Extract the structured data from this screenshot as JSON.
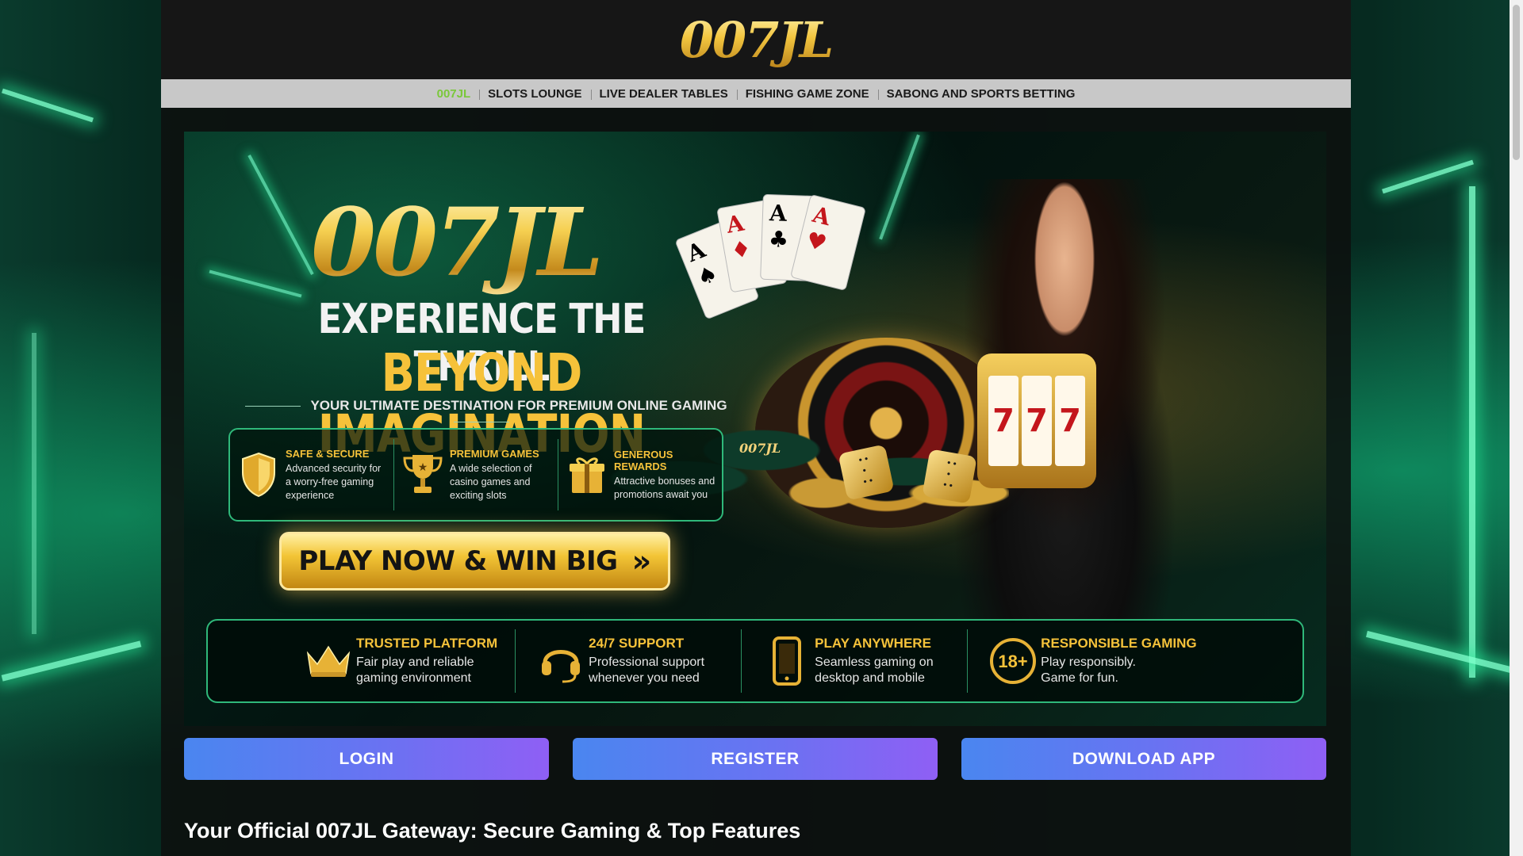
{
  "site": {
    "logo_text": "007JL"
  },
  "nav": {
    "items": [
      {
        "label": "007JL",
        "active": true
      },
      {
        "label": "SLOTS LOUNGE",
        "active": false
      },
      {
        "label": "LIVE DEALER TABLES",
        "active": false
      },
      {
        "label": "FISHING GAME ZONE",
        "active": false
      },
      {
        "label": "SABONG AND SPORTS BETTING",
        "active": false
      }
    ]
  },
  "banner": {
    "logo_text": "007JL",
    "headline_1": "EXPERIENCE THE THRILL",
    "headline_2": "BEYOND IMAGINATION",
    "tagline": "YOUR ULTIMATE DESTINATION FOR PREMIUM ONLINE GAMING",
    "features": [
      {
        "icon": "shield-icon",
        "title": "SAFE & SECURE",
        "desc": "Advanced security for a worry-free gaming experience"
      },
      {
        "icon": "trophy-icon",
        "title": "PREMIUM GAMES",
        "desc": "A wide selection of casino games and exciting slots"
      },
      {
        "icon": "gift-icon",
        "title": "GENEROUS REWARDS",
        "desc": "Attractive bonuses and promotions await you"
      }
    ],
    "cta_label": "PLAY NOW & WIN BIG",
    "cta_chevron": "»",
    "card_ranks": [
      "A",
      "A",
      "A",
      "A"
    ],
    "card_suits": [
      "♠",
      "♦",
      "♣",
      "♥"
    ],
    "slot_reels": [
      "7",
      "7",
      "7"
    ],
    "chip_label": "007JL",
    "trust": [
      {
        "icon": "crown-icon",
        "title": "TRUSTED PLATFORM",
        "desc": "Fair play and reliable gaming environment"
      },
      {
        "icon": "headset-icon",
        "title": "24/7 SUPPORT",
        "desc": "Professional support whenever you need"
      },
      {
        "icon": "phone-icon",
        "title": "PLAY ANYWHERE",
        "desc": "Seamless gaming on desktop and mobile"
      },
      {
        "icon": "age-18-icon",
        "title": "RESPONSIBLE GAMING",
        "desc": "Play responsibly. Game for fun.",
        "badge": "18+"
      }
    ]
  },
  "actions": {
    "login": "LOGIN",
    "register": "REGISTER",
    "download": "DOWNLOAD APP"
  },
  "section": {
    "title": "Your Official 007JL Gateway: Secure Gaming & Top Features"
  },
  "colors": {
    "gold": "#f6c23a",
    "neon_green": "#2fb87a",
    "nav_active": "#7ac83a",
    "button_start": "#4a86f0",
    "button_end": "#8f5ff4"
  }
}
